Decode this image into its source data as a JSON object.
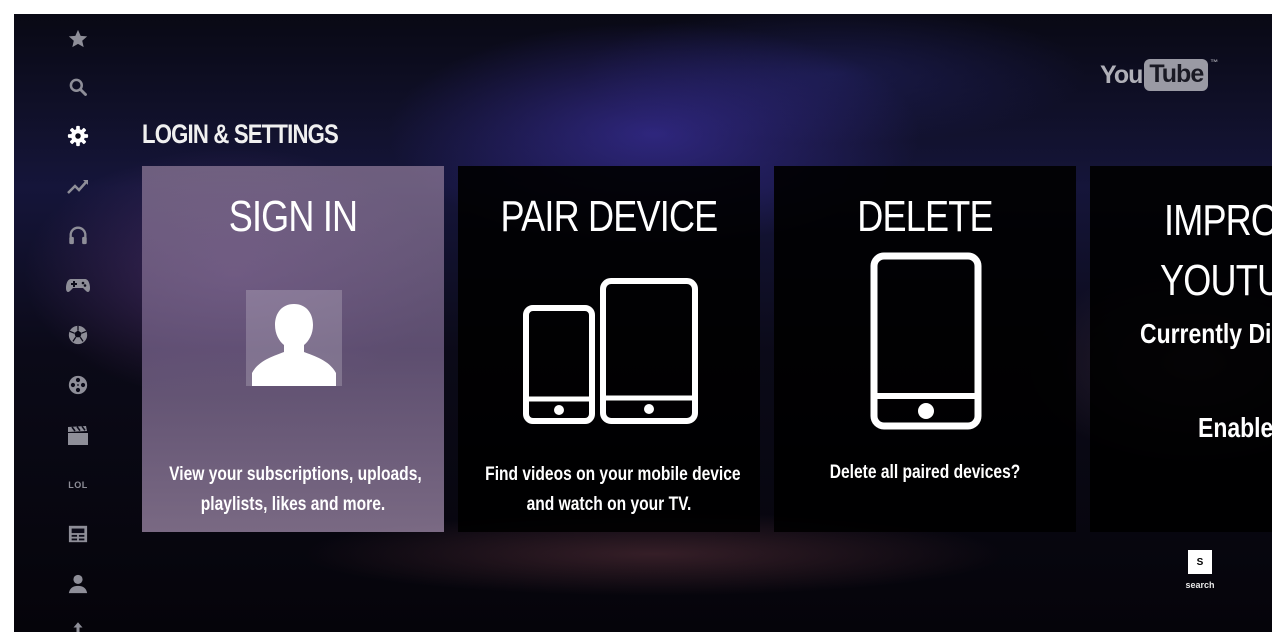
{
  "colors": {
    "background": "#0b0a18",
    "accent_purple": "#3f37b6",
    "selected_card": "#8c7896",
    "card": "#000000",
    "text": "#ffffff",
    "nav_icon": "#8e8e98"
  },
  "sidebar": {
    "items": [
      {
        "icon": "star-icon",
        "label": ""
      },
      {
        "icon": "search-icon",
        "label": ""
      },
      {
        "icon": "gear-icon",
        "label": "",
        "active": true
      },
      {
        "icon": "trending-icon",
        "label": ""
      },
      {
        "icon": "headphones-icon",
        "label": ""
      },
      {
        "icon": "gamepad-icon",
        "label": ""
      },
      {
        "icon": "soccer-ball-icon",
        "label": ""
      },
      {
        "icon": "film-reel-icon",
        "label": ""
      },
      {
        "icon": "clapperboard-icon",
        "label": ""
      },
      {
        "icon": "lol-icon",
        "label": "LOL"
      },
      {
        "icon": "news-icon",
        "label": ""
      },
      {
        "icon": "user-icon",
        "label": ""
      },
      {
        "icon": "upload-icon",
        "label": ""
      }
    ]
  },
  "logo": {
    "you": "You",
    "tube": "Tube",
    "tm": "™"
  },
  "section": {
    "title": "LOGIN & SETTINGS"
  },
  "cards": [
    {
      "title": "SIGN IN",
      "icon": "user-silhouette-icon",
      "desc_line1": "View your subscriptions, uploads,",
      "desc_line2": "playlists, likes and more.",
      "selected": true
    },
    {
      "title": "PAIR DEVICE",
      "icon": "tablet-phone-icon",
      "desc_line1": "Find videos on your mobile device",
      "desc_line2": "and watch on your TV."
    },
    {
      "title": "DELETE",
      "icon": "phone-icon",
      "desc_line1": "Delete all paired devices?"
    },
    {
      "title_line1": "IMPRO",
      "title_line2": "YOUTU",
      "status": "Currently Di",
      "action": "Enable"
    }
  ],
  "search_hint": {
    "key": "S",
    "label": "search"
  }
}
